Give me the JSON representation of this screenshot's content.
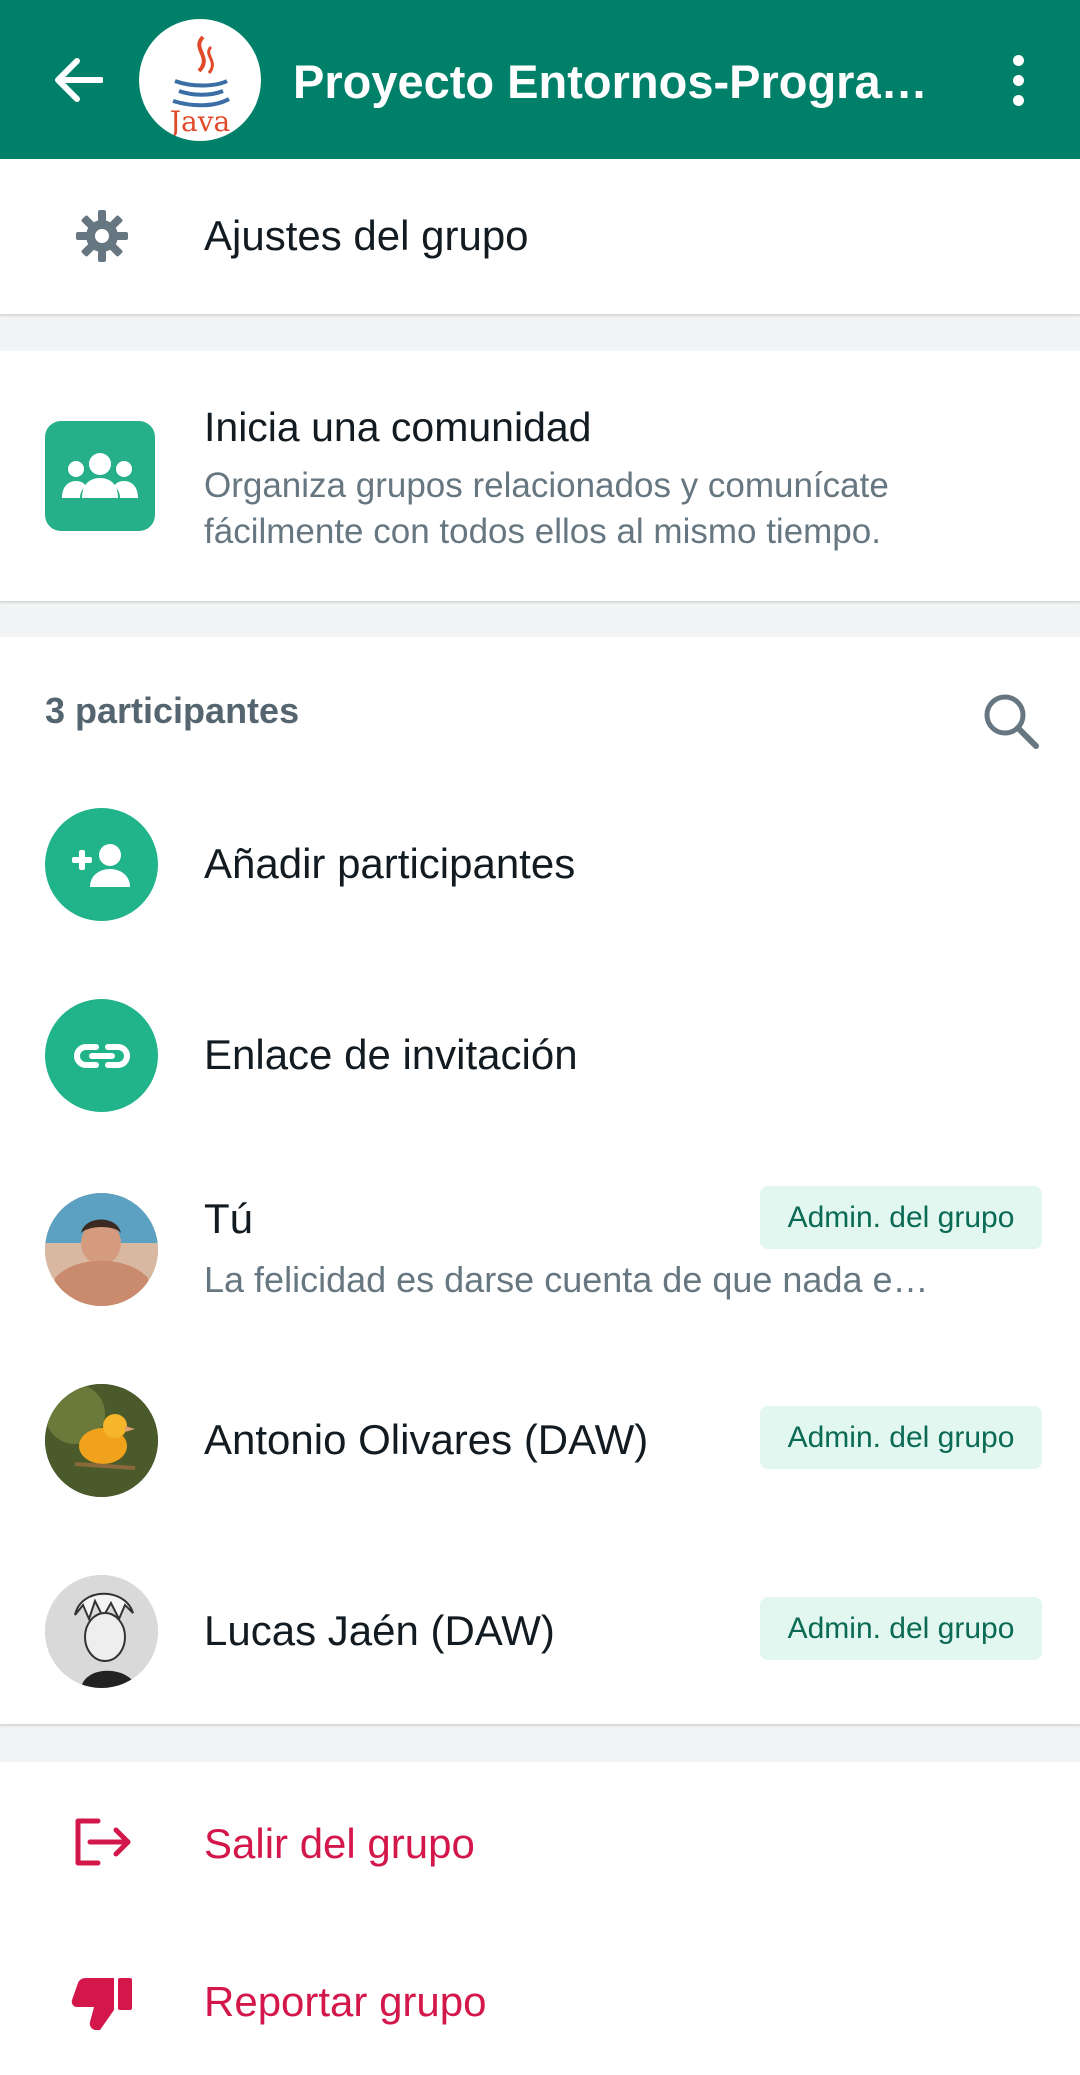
{
  "header": {
    "title": "Proyecto Entornos-Progra…",
    "avatar_text": "Java",
    "back_icon": "arrow-back-icon",
    "menu_icon": "more-vertical-icon",
    "bg_color": "#008069"
  },
  "settings": {
    "label": "Ajustes del grupo",
    "icon": "gear-icon"
  },
  "community": {
    "title": "Inicia una comunidad",
    "desc_line1": "Organiza grupos relacionados y comunícate",
    "desc_line2": "fácilmente con todos ellos al mismo tiempo.",
    "icon": "community-icon"
  },
  "participants": {
    "count_label": "3 participantes",
    "search_icon": "search-icon",
    "add_label": "Añadir participantes",
    "invite_label": "Enlace de invitación",
    "members": [
      {
        "name": "Tú",
        "status": "La felicidad es darse cuenta de que nada e…",
        "badge": "Admin. del grupo"
      },
      {
        "name": "Antonio Olivares (DAW)",
        "badge": "Admin. del grupo"
      },
      {
        "name": "Lucas Jaén (DAW)",
        "badge": "Admin. del grupo"
      }
    ]
  },
  "actions": {
    "exit_label": "Salir del grupo",
    "report_label": "Reportar grupo",
    "danger_color": "#d4174a"
  }
}
